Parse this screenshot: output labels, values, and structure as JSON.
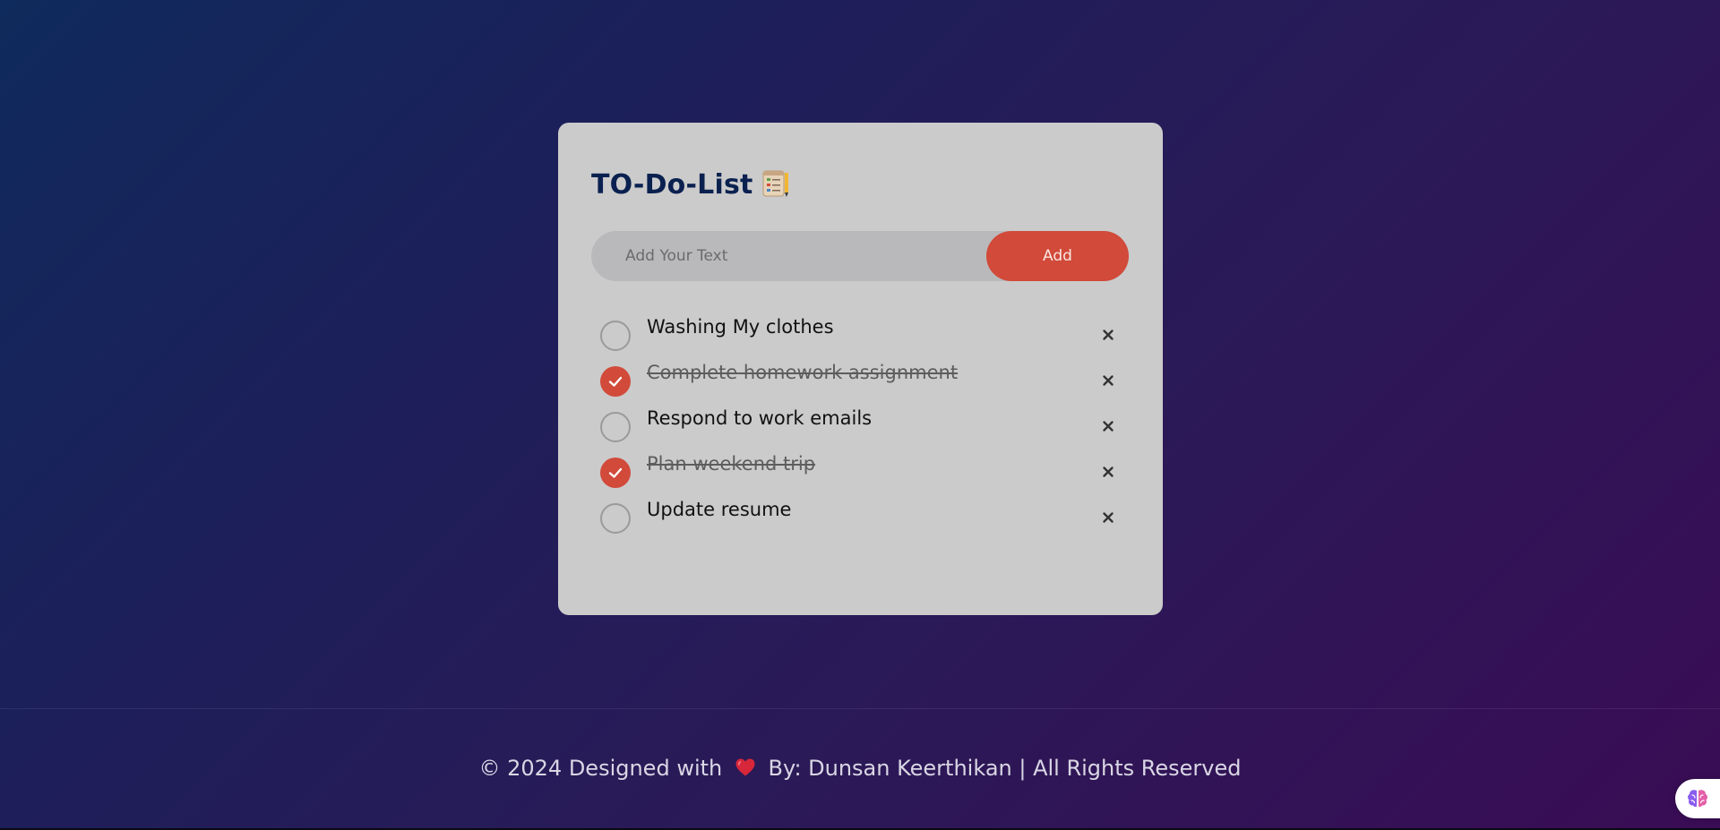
{
  "app": {
    "title": "TO-Do-List",
    "title_icon": "checklist-notepad-icon"
  },
  "input": {
    "placeholder": "Add Your Text",
    "value": "",
    "add_label": "Add"
  },
  "tasks": [
    {
      "text": "Washing My clothes",
      "done": false
    },
    {
      "text": "Complete homework assignment",
      "done": true
    },
    {
      "text": "Respond to work emails",
      "done": false
    },
    {
      "text": "Plan weekend trip",
      "done": true
    },
    {
      "text": "Update resume",
      "done": false
    }
  ],
  "footer": {
    "prefix": "© 2024 Designed with",
    "suffix": "By: Dunsan Keerthikan | All Rights Reserved"
  },
  "colors": {
    "accent": "#d14a3a",
    "title": "#0a2150",
    "card": "#cbcbcb",
    "input_bg": "#b9b9bb"
  },
  "icons": {
    "check": "checkmark-icon",
    "delete": "close-icon",
    "heart": "heart-icon",
    "widget": "brain-icon"
  }
}
